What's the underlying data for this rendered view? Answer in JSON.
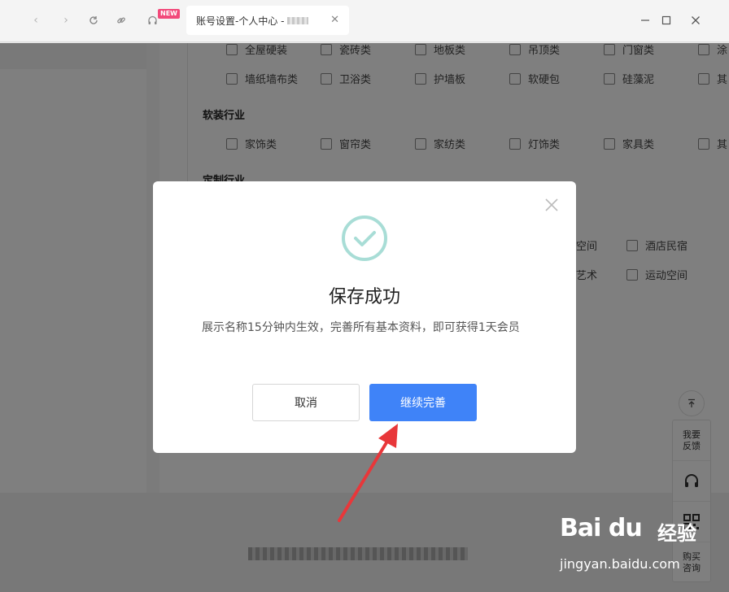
{
  "browser": {
    "new_badge": "NEW",
    "tab_title": "账号设置-个人中心 -",
    "tab_close": "✕"
  },
  "page": {
    "rows_top": [
      [
        "全屋硬装",
        "瓷砖类",
        "地板类",
        "吊顶类",
        "门窗类",
        "涂"
      ],
      [
        "墙纸墙布类",
        "卫浴类",
        "护墙板",
        "软硬包",
        "硅藻泥",
        "其"
      ]
    ],
    "soft_title": "软装行业",
    "soft_row": [
      "家饰类",
      "窗帘类",
      "家纺类",
      "灯饰类",
      "家具类",
      "其"
    ],
    "custom_title": "定制行业",
    "hidden_row_1": [
      "空间",
      "酒店民宿"
    ],
    "hidden_row_2": [
      "艺术",
      "运动空间"
    ]
  },
  "side_toolbar": {
    "feedback": "我要\n反馈",
    "buy": "购买\n咨询"
  },
  "dialog": {
    "title": "保存成功",
    "message": "展示名称15分钟内生效，完善所有基本资料，即可获得1天会员",
    "cancel": "取消",
    "continue": "继续完善"
  },
  "watermark": {
    "brand": "Bai du",
    "jingyan": "经验",
    "url": "jingyan.baidu.com"
  },
  "colors": {
    "primary": "#3f83f8",
    "success_icon": "#a8ddd6",
    "annotation": "#e8373a",
    "new_badge": "#f2497a"
  }
}
